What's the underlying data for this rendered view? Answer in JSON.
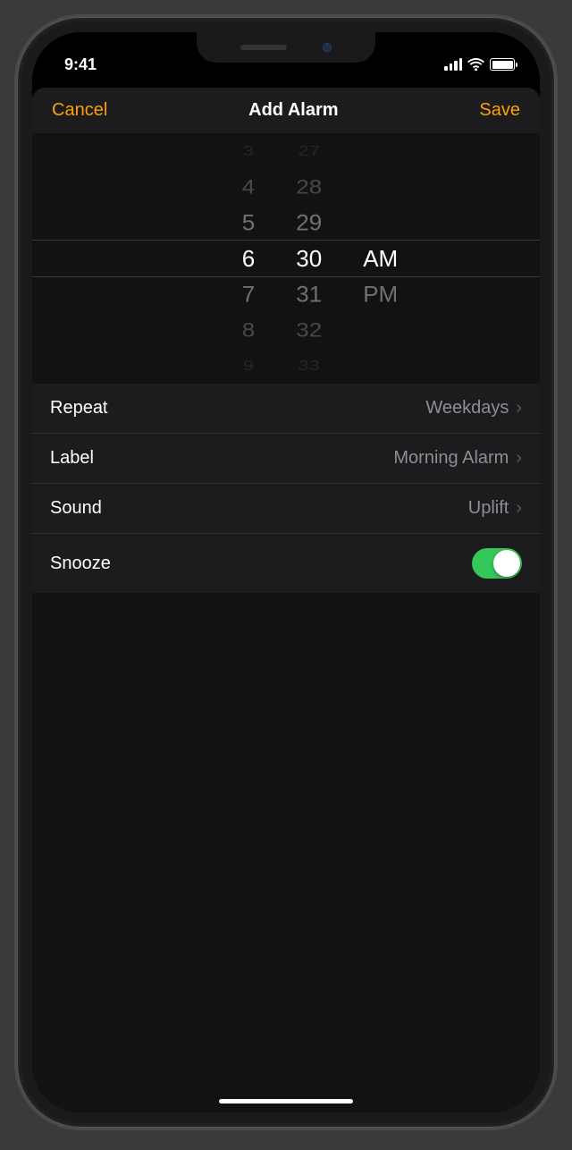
{
  "status": {
    "time": "9:41"
  },
  "nav": {
    "cancel": "Cancel",
    "title": "Add Alarm",
    "save": "Save"
  },
  "picker": {
    "hours": {
      "m3": "3",
      "m2": "4",
      "m1": "5",
      "sel": "6",
      "p1": "7",
      "p2": "8",
      "p3": "9"
    },
    "minutes": {
      "m3": "27",
      "m2": "28",
      "m1": "29",
      "sel": "30",
      "p1": "31",
      "p2": "32",
      "p3": "33"
    },
    "ampm": {
      "sel": "AM",
      "other": "PM"
    }
  },
  "settings": {
    "repeat": {
      "label": "Repeat",
      "value": "Weekdays"
    },
    "label": {
      "label": "Label",
      "value": "Morning Alarm"
    },
    "sound": {
      "label": "Sound",
      "value": "Uplift"
    },
    "snooze": {
      "label": "Snooze",
      "on": true
    }
  }
}
